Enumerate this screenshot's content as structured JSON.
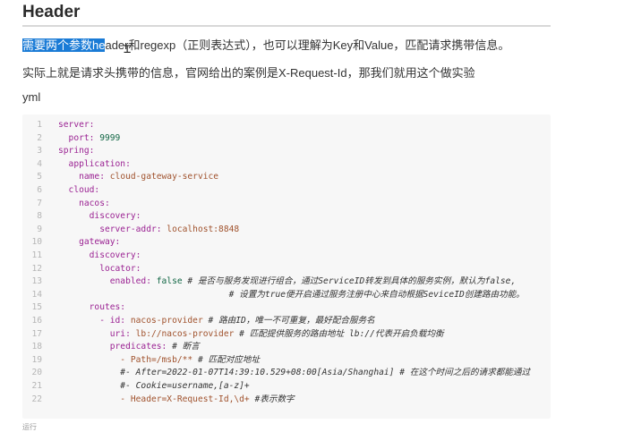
{
  "heading": "Header",
  "paragraph1": {
    "selected": "需要两个参数he",
    "rest": "ader和regexp（正则表达式），也可以理解为Key和Value，匹配请求携带信息。"
  },
  "paragraph2": "实际上就是请求头携带的信息，官网给出的案例是X-Request-Id，那我们就用这个做实验",
  "code_lang": "yml",
  "code_lines": [
    {
      "n": "1",
      "parts": [
        {
          "t": "server:",
          "c": "k"
        }
      ]
    },
    {
      "n": "2",
      "parts": [
        {
          "t": "  port: ",
          "c": "k"
        },
        {
          "t": "9999",
          "c": "num"
        }
      ]
    },
    {
      "n": "3",
      "parts": [
        {
          "t": "spring:",
          "c": "k"
        }
      ]
    },
    {
      "n": "4",
      "parts": [
        {
          "t": "  application:",
          "c": "k"
        }
      ]
    },
    {
      "n": "5",
      "parts": [
        {
          "t": "    name: ",
          "c": "k"
        },
        {
          "t": "cloud-gateway-service",
          "c": "s"
        }
      ]
    },
    {
      "n": "6",
      "parts": [
        {
          "t": "  cloud:",
          "c": "k"
        }
      ]
    },
    {
      "n": "7",
      "parts": [
        {
          "t": "    nacos:",
          "c": "k"
        }
      ]
    },
    {
      "n": "8",
      "parts": [
        {
          "t": "      discovery:",
          "c": "k"
        }
      ]
    },
    {
      "n": "9",
      "parts": [
        {
          "t": "        server-addr: ",
          "c": "k"
        },
        {
          "t": "localhost:8848",
          "c": "s"
        }
      ]
    },
    {
      "n": "10",
      "parts": [
        {
          "t": "    gateway:",
          "c": "k"
        }
      ]
    },
    {
      "n": "11",
      "parts": [
        {
          "t": "      discovery:",
          "c": "k"
        }
      ]
    },
    {
      "n": "12",
      "parts": [
        {
          "t": "        locator:",
          "c": "k"
        }
      ]
    },
    {
      "n": "13",
      "parts": [
        {
          "t": "          enabled: ",
          "c": "k"
        },
        {
          "t": "false",
          "c": "num"
        },
        {
          "t": " # 是否与服务发现进行组合，通过ServiceID转发到具体的服务实例，默认为false,",
          "c": "c"
        }
      ]
    },
    {
      "n": "14",
      "parts": [
        {
          "t": "                                 # 设置为true便开启通过服务注册中心来自动根据SeviceID创建路由功能。",
          "c": "c"
        }
      ]
    },
    {
      "n": "15",
      "parts": [
        {
          "t": "      routes:",
          "c": "k"
        }
      ]
    },
    {
      "n": "16",
      "parts": [
        {
          "t": "        - id: ",
          "c": "k"
        },
        {
          "t": "nacos-provider",
          "c": "s"
        },
        {
          "t": " # 路由ID，唯一不可重复，最好配合服务名",
          "c": "c"
        }
      ]
    },
    {
      "n": "17",
      "parts": [
        {
          "t": "          uri: ",
          "c": "k"
        },
        {
          "t": "lb://nacos-provider",
          "c": "s"
        },
        {
          "t": " # 匹配提供服务的路由地址 lb://代表开启负载均衡",
          "c": "c"
        }
      ]
    },
    {
      "n": "18",
      "parts": [
        {
          "t": "          predicates: ",
          "c": "k"
        },
        {
          "t": "# 断言",
          "c": "c"
        }
      ]
    },
    {
      "n": "19",
      "parts": [
        {
          "t": "            - Path=/msb/** ",
          "c": "s"
        },
        {
          "t": "# 匹配对应地址",
          "c": "c"
        }
      ]
    },
    {
      "n": "20",
      "parts": [
        {
          "t": "            #- After=2022-01-07T14:39:10.529+08:00[Asia/Shanghai] # 在这个时间之后的请求都能通过",
          "c": "c"
        }
      ]
    },
    {
      "n": "21",
      "parts": [
        {
          "t": "            #- Cookie=username,[a-z]+",
          "c": "c"
        }
      ]
    },
    {
      "n": "22",
      "parts": [
        {
          "t": "            - Header=X-Request-Id,\\d+ ",
          "c": "s"
        },
        {
          "t": "#表示数字",
          "c": "c"
        }
      ]
    }
  ],
  "footer_fragment": "运行"
}
